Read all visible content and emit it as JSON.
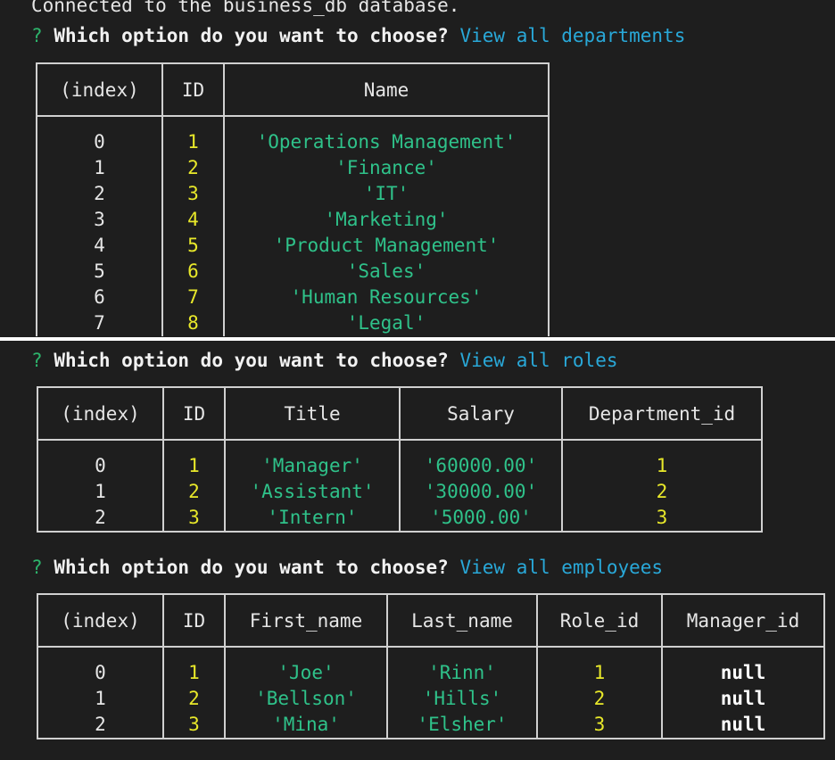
{
  "terminal": {
    "connected_line": "Connected to the business_db database.",
    "question_mark": "?",
    "prompt": "Which option do you want to choose?"
  },
  "departments": {
    "answer": "View all departments",
    "headers": [
      "(index)",
      "ID",
      "Name"
    ],
    "rows": [
      [
        "0",
        "1",
        "'Operations Management'"
      ],
      [
        "1",
        "2",
        "'Finance'"
      ],
      [
        "2",
        "3",
        "'IT'"
      ],
      [
        "3",
        "4",
        "'Marketing'"
      ],
      [
        "4",
        "5",
        "'Product Management'"
      ],
      [
        "5",
        "6",
        "'Sales'"
      ],
      [
        "6",
        "7",
        "'Human Resources'"
      ],
      [
        "7",
        "8",
        "'Legal'"
      ]
    ]
  },
  "roles": {
    "answer": "View all roles",
    "headers": [
      "(index)",
      "ID",
      "Title",
      "Salary",
      "Department_id"
    ],
    "rows": [
      [
        "0",
        "1",
        "'Manager'",
        "'60000.00'",
        "1"
      ],
      [
        "1",
        "2",
        "'Assistant'",
        "'30000.00'",
        "2"
      ],
      [
        "2",
        "3",
        "'Intern'",
        "'5000.00'",
        "3"
      ]
    ]
  },
  "employees": {
    "answer": "View all employees",
    "headers": [
      "(index)",
      "ID",
      "First_name",
      "Last_name",
      "Role_id",
      "Manager_id"
    ],
    "rows": [
      [
        "0",
        "1",
        "'Joe'",
        "'Rinn'",
        "1",
        "null"
      ],
      [
        "1",
        "2",
        "'Bellson'",
        "'Hills'",
        "2",
        "null"
      ],
      [
        "2",
        "3",
        "'Mina'",
        "'Elsher'",
        "3",
        "null"
      ]
    ]
  },
  "colors": {
    "background": "#1e1e1e",
    "question_mark": "#2db36b",
    "answer": "#29a8d8",
    "number": "#e8e82a",
    "string": "#2fc28a"
  }
}
